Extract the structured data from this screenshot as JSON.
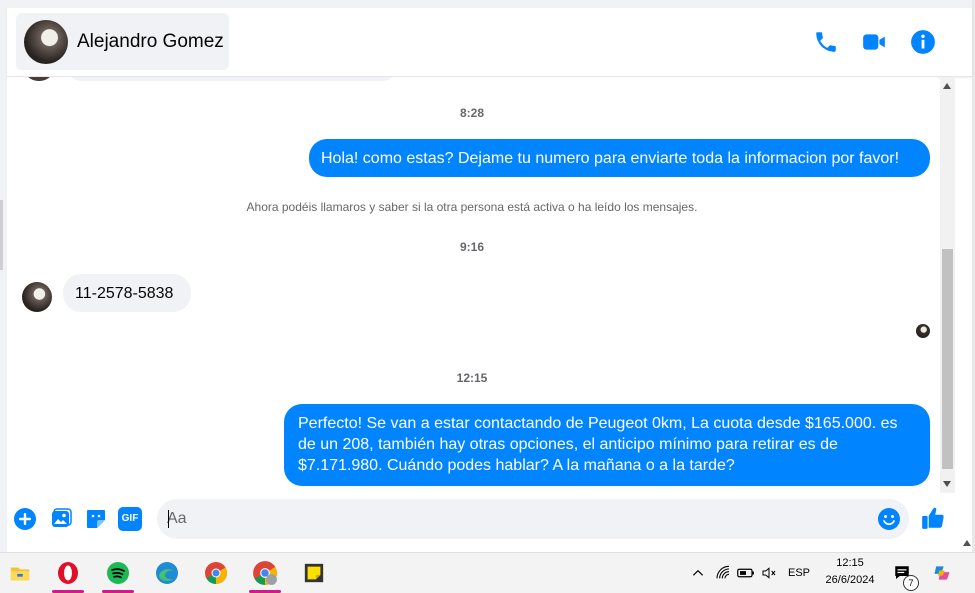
{
  "header": {
    "contact_name": "Alejandro Gomez",
    "icons": [
      "phone-icon",
      "video-camera-icon",
      "info-icon"
    ],
    "accent_color": "#0084ff"
  },
  "conversation": {
    "time_1": "8:28",
    "msg_out_1": "Hola! como estas? Dejame tu numero para enviarte toda la informacion por favor!",
    "system_note": "Ahora podéis llamaros y saber si la otra persona está activa o ha leído los mensajes.",
    "time_2": "9:16",
    "msg_in_1": "11-2578-5838",
    "time_3": "12:15",
    "msg_out_2": "Perfecto!  Se van a estar contactando de Peugeot 0km, La cuota desde $165.000. es de un 208, también hay otras opciones, el anticipo mínimo para retirar es de $7.171.980. Cuándo podes hablar? A la mañana o a la tarde?"
  },
  "composer": {
    "placeholder": "Aa",
    "icons": [
      "plus-icon",
      "image-icon",
      "sticker-icon",
      "gif-icon",
      "emoji-icon",
      "thumbs-up-icon"
    ],
    "gif_label": "GIF"
  },
  "taskbar": {
    "apps": [
      "file-explorer-icon",
      "opera-icon",
      "spotify-icon",
      "edge-icon",
      "chrome-icon",
      "chrome-profile-icon",
      "sticky-notes-icon"
    ],
    "tray_language": "ESP",
    "clock_time": "12:15",
    "clock_date": "26/6/2024",
    "notification_count": "7"
  }
}
